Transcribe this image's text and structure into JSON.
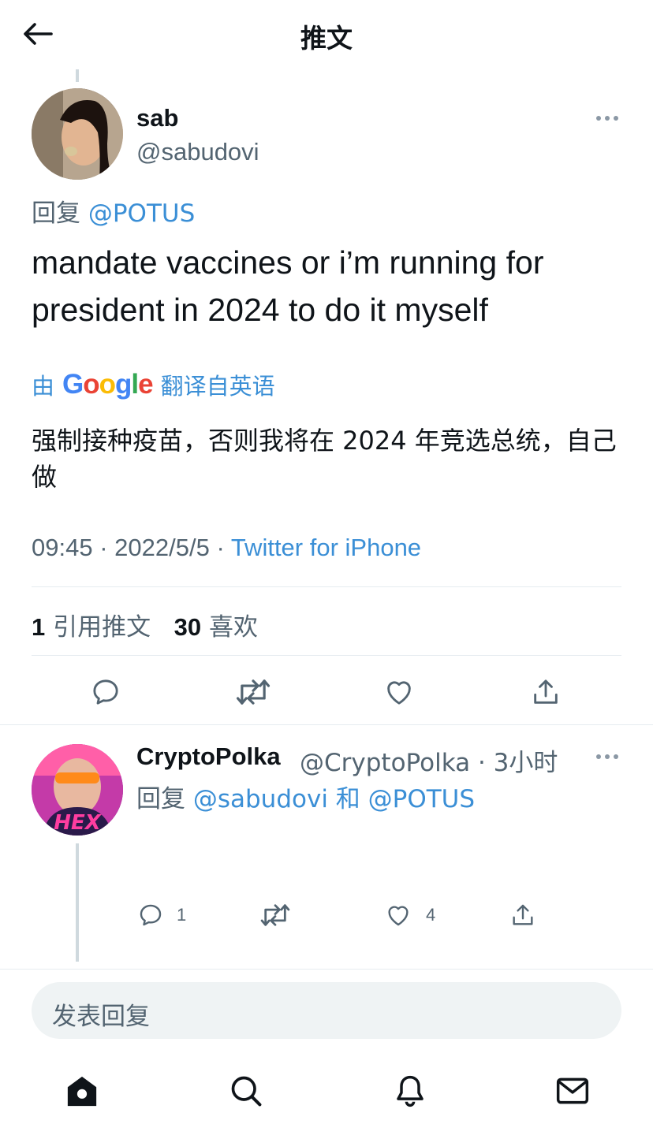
{
  "header": {
    "title": "推文",
    "back_icon": "arrow-left-icon"
  },
  "tweet": {
    "author_name": "sab",
    "author_handle": "@sabudovi",
    "reply_prefix": "回复 ",
    "reply_mention": "@POTUS",
    "text": "mandate vaccines or i’m running for president in 2024 to do it myself",
    "translate_prefix": "由",
    "translate_brand": "Google",
    "translate_suffix": "翻译自英语",
    "translated_text": "强制接种疫苗，否则我将在 2024 年竞选总统，自己做",
    "time": "09:45",
    "date": "2022/5/5",
    "source": "Twitter for iPhone",
    "quote_count": "1",
    "quote_label": "引用推文",
    "like_count": "30",
    "like_label": "喜欢"
  },
  "reply": {
    "author_name": "CryptoPolka",
    "author_handle": "@CryptoPolka",
    "time_ago": "3小时",
    "reply_prefix": "回复 ",
    "mention_1": "@sabudovi",
    "conjunction": " 和 ",
    "mention_2": "@POTUS",
    "reply_count": "1",
    "like_count": "4"
  },
  "compose": {
    "placeholder": "发表回复"
  },
  "colors": {
    "accent": "#3b8fd6",
    "muted": "#536471",
    "divider": "#e6ecf0"
  },
  "tabbar": [
    "home-icon",
    "search-icon",
    "bell-icon",
    "mail-icon"
  ]
}
